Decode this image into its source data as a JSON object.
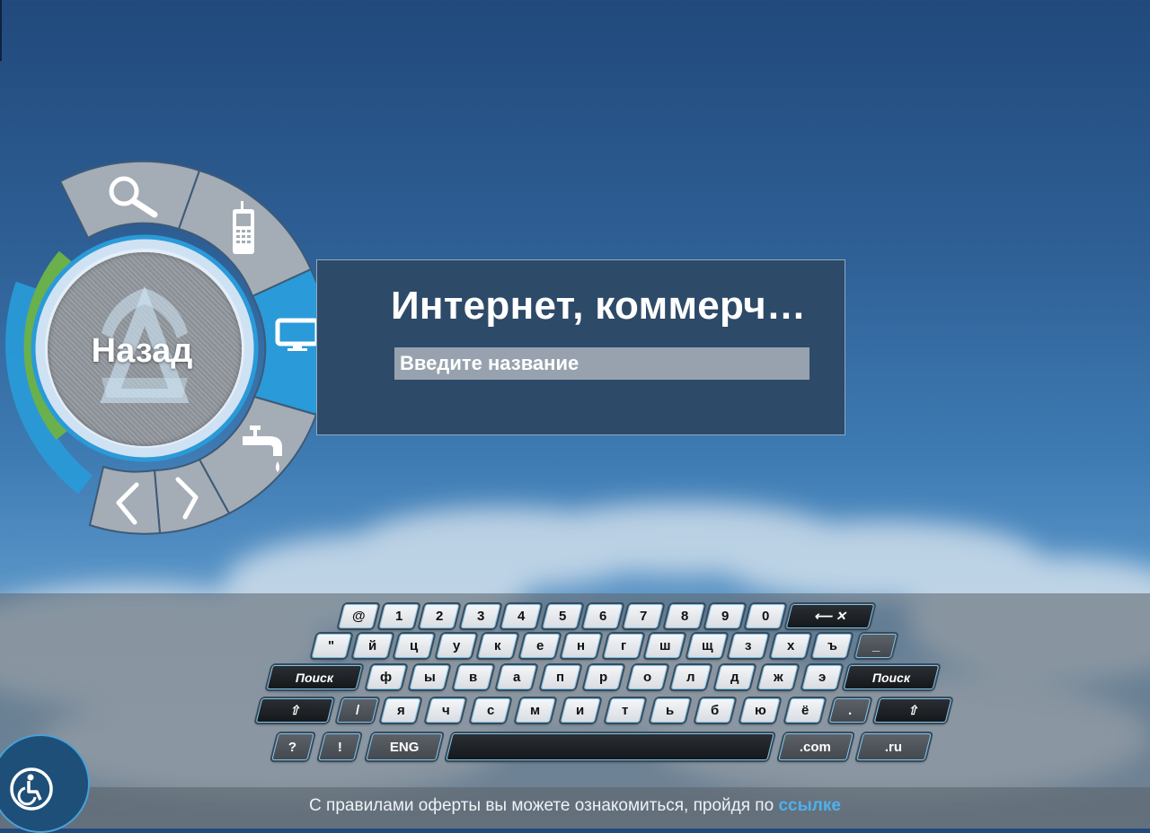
{
  "colors": {
    "accent_blue": "#2a9ad8",
    "menu_gray": "#a4acb5",
    "hub_ring": "#cfe2f3",
    "green_arc": "#6ab04c",
    "panel_bg": "#2e4a69",
    "link": "#4fb0ee"
  },
  "radial_menu": {
    "back_label": "Назад",
    "items": [
      {
        "icon": "search-icon"
      },
      {
        "icon": "mobile-phone-icon"
      },
      {
        "icon": "tv-monitor-icon",
        "active": true
      },
      {
        "icon": "water-tap-icon"
      },
      {
        "icon": "chevron-right-icon"
      },
      {
        "icon": "chevron-left-icon"
      }
    ]
  },
  "panel": {
    "title": "Интернет, коммерч…",
    "input_placeholder": "Введите название"
  },
  "keyboard": {
    "rows": [
      [
        "@",
        "1",
        "2",
        "3",
        "4",
        "5",
        "6",
        "7",
        "8",
        "9",
        "0"
      ],
      [
        "\"",
        "й",
        "ц",
        "у",
        "к",
        "е",
        "н",
        "г",
        "ш",
        "щ",
        "з",
        "х",
        "ъ",
        "_"
      ],
      [
        "Поиск",
        "ф",
        "ы",
        "в",
        "а",
        "п",
        "р",
        "о",
        "л",
        "д",
        "ж",
        "э",
        "Поиск"
      ],
      [
        "⇧",
        "/",
        "я",
        "ч",
        "с",
        "м",
        "и",
        "т",
        "ь",
        "б",
        "ю",
        "ё",
        ".",
        "⇧"
      ],
      [
        "?",
        "!",
        "ENG",
        "",
        ".com",
        ".ru"
      ]
    ],
    "backspace_label": "⟵  ✕"
  },
  "footer": {
    "text": "С правилами оферты вы можете ознакомиться, пройдя по",
    "link": "ссылке"
  }
}
